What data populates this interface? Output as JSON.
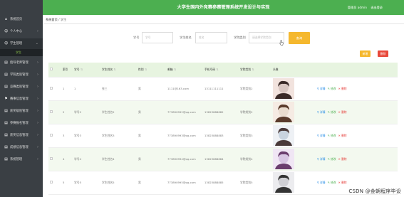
{
  "header": {
    "title": "大学生国内外竞赛参赛管理系统开发设计与实现",
    "user": "管理员 admin",
    "logout": "退出登录"
  },
  "sidebar": {
    "items": [
      {
        "icon": "⌂",
        "label": "系统首页"
      },
      {
        "icon": "☺",
        "label": "个人中心",
        "arrow": "›"
      },
      {
        "icon": "☺",
        "label": "学生管理",
        "arrow": "⌄"
      },
      {
        "icon": "▤",
        "label": "指导老师管理",
        "arrow": "›"
      },
      {
        "icon": "▤",
        "label": "学院类别管理",
        "arrow": "›"
      },
      {
        "icon": "▤",
        "label": "竞赛类别管理",
        "arrow": "›"
      },
      {
        "icon": "⚑",
        "label": "赛事信息管理",
        "arrow": "›"
      },
      {
        "icon": "▤",
        "label": "获奖级别管理",
        "arrow": "›"
      },
      {
        "icon": "▤",
        "label": "参赛报名管理",
        "arrow": "›"
      },
      {
        "icon": "▤",
        "label": "获奖信息管理",
        "arrow": "›"
      },
      {
        "icon": "▤",
        "label": "成绩信息管理",
        "arrow": "›"
      },
      {
        "icon": "▤",
        "label": "系统管理",
        "arrow": "›"
      }
    ],
    "sub": "学生"
  },
  "breadcrumb": {
    "home": "系统首页",
    "sep": "/",
    "current": "学生"
  },
  "search": {
    "f1_label": "学号",
    "f1_ph": "学号",
    "f2_label": "学生姓名",
    "f2_ph": "姓名",
    "f3_label": "学院类别",
    "f3_ph": "请选择学院类别",
    "button": "查询"
  },
  "actions": {
    "add": "新增",
    "delete": "删除"
  },
  "table": {
    "headers": [
      "索引",
      "学号",
      "学生姓名",
      "性别",
      "邮箱",
      "手机号码",
      "学院类别",
      "头像"
    ],
    "ops": {
      "detail": "详情",
      "edit": "修改",
      "delete": "删除"
    },
    "rows": [
      {
        "idx": "1",
        "no": "1",
        "name": "张三",
        "sex": "男",
        "email": "1111@163.com",
        "phone": "13111111111",
        "college": "学院类别2"
      },
      {
        "idx": "2",
        "no": "学号2",
        "name": "学生姓名2",
        "sex": "男",
        "email": "773890992@qq.com",
        "phone": "13823888882",
        "college": "学院类别2"
      },
      {
        "idx": "3",
        "no": "学号3",
        "name": "学生姓名3",
        "sex": "男",
        "email": "773890993@qq.com",
        "phone": "13823888883",
        "college": "学院类别3"
      },
      {
        "idx": "4",
        "no": "学号4",
        "name": "学生姓名4",
        "sex": "男",
        "email": "773890994@qq.com",
        "phone": "13823888884",
        "college": "学院类别4"
      },
      {
        "idx": "5",
        "no": "学号5",
        "name": "学生姓名5",
        "sex": "男",
        "email": "773890995@qq.com",
        "phone": "13823888885",
        "college": "学院类别5"
      }
    ]
  },
  "colors": {
    "green": "#4caf50",
    "sidebar": "#3a3f44",
    "query": "#f5b82e",
    "add": "#f5b82e",
    "delete": "#e8483a"
  },
  "watermark": "CSDN @金朝程序毕设"
}
